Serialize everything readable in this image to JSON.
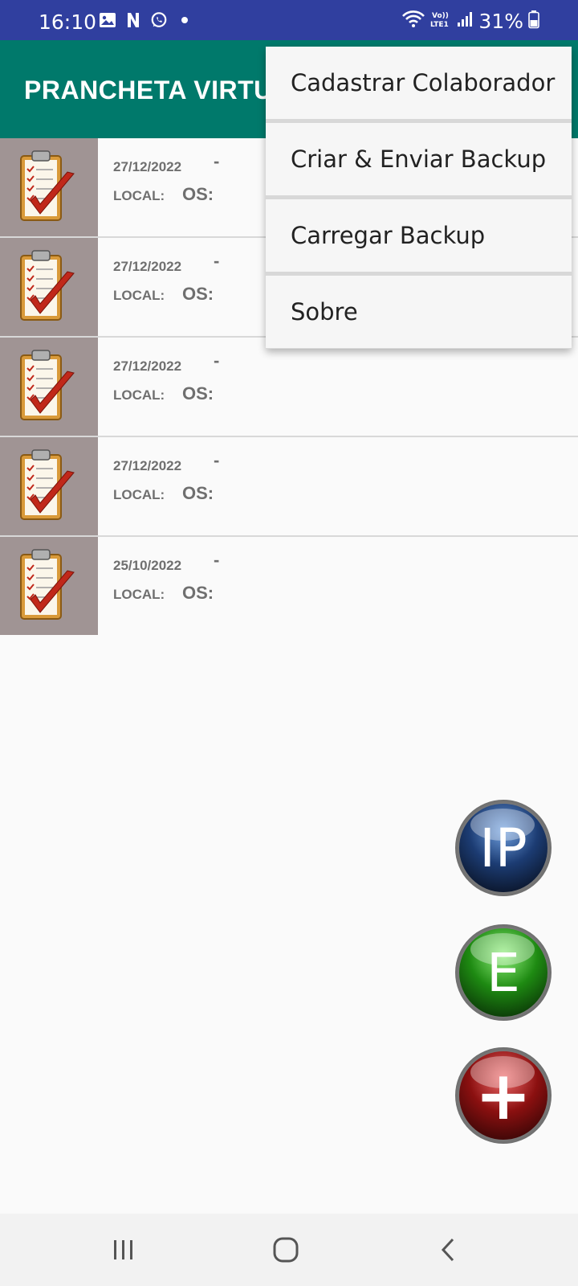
{
  "status_bar": {
    "time": "16:10",
    "battery_pct": "31%",
    "left_icons": [
      "gallery-icon",
      "n-app-icon",
      "whatsapp-icon",
      "dot-icon"
    ],
    "right_icons": [
      "wifi-icon",
      "volte-lte-icon",
      "signal-icon",
      "battery-icon"
    ],
    "volte_text": "Vo)) LTE1"
  },
  "app_bar": {
    "title": "PRANCHETA VIRTU",
    "color": "#00796b"
  },
  "list": {
    "items": [
      {
        "date": "27/12/2022",
        "dash": "-",
        "local_label": "LOCAL:",
        "os_label": "OS:"
      },
      {
        "date": "27/12/2022",
        "dash": "-",
        "local_label": "LOCAL:",
        "os_label": "OS:"
      },
      {
        "date": "27/12/2022",
        "dash": "-",
        "local_label": "LOCAL:",
        "os_label": "OS:"
      },
      {
        "date": "27/12/2022",
        "dash": "-",
        "local_label": "LOCAL:",
        "os_label": "OS:"
      },
      {
        "date": "25/10/2022",
        "dash": "-",
        "local_label": "LOCAL:",
        "os_label": "OS:"
      }
    ],
    "thumb_icon": "clipboard-check-icon"
  },
  "menu": {
    "items": [
      {
        "label": "Cadastrar Colaborador"
      },
      {
        "label": "Criar & Enviar Backup"
      },
      {
        "label": "Carregar Backup"
      },
      {
        "label": "Sobre"
      }
    ]
  },
  "fabs": {
    "ip_label": "IP",
    "e_label": "E",
    "add_label": "+"
  },
  "nav_bar": {
    "icons": [
      "recent-apps-icon",
      "home-icon",
      "back-icon"
    ]
  },
  "colors": {
    "status_bar": "#303f9f",
    "app_bar": "#00796b",
    "thumb_bg": "#a09494"
  }
}
